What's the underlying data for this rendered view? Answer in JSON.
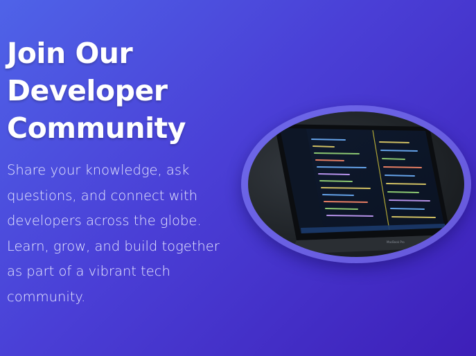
{
  "hero": {
    "title_lines": [
      "Join Our",
      "Developer",
      "Community"
    ],
    "description_lines": [
      "Share your knowledge, ask",
      "questions, and connect with",
      "developers across the globe.",
      "Learn, grow, and build together",
      "as part of a vibrant tech",
      "community."
    ]
  },
  "image": {
    "subject": "laptop-with-code-editor",
    "bezel_label": "MacBook Pro"
  },
  "colors": {
    "background_start": "#4f63e8",
    "background_end": "#3d1fb8",
    "text": "#ffffff",
    "ring": "#9696ff"
  }
}
